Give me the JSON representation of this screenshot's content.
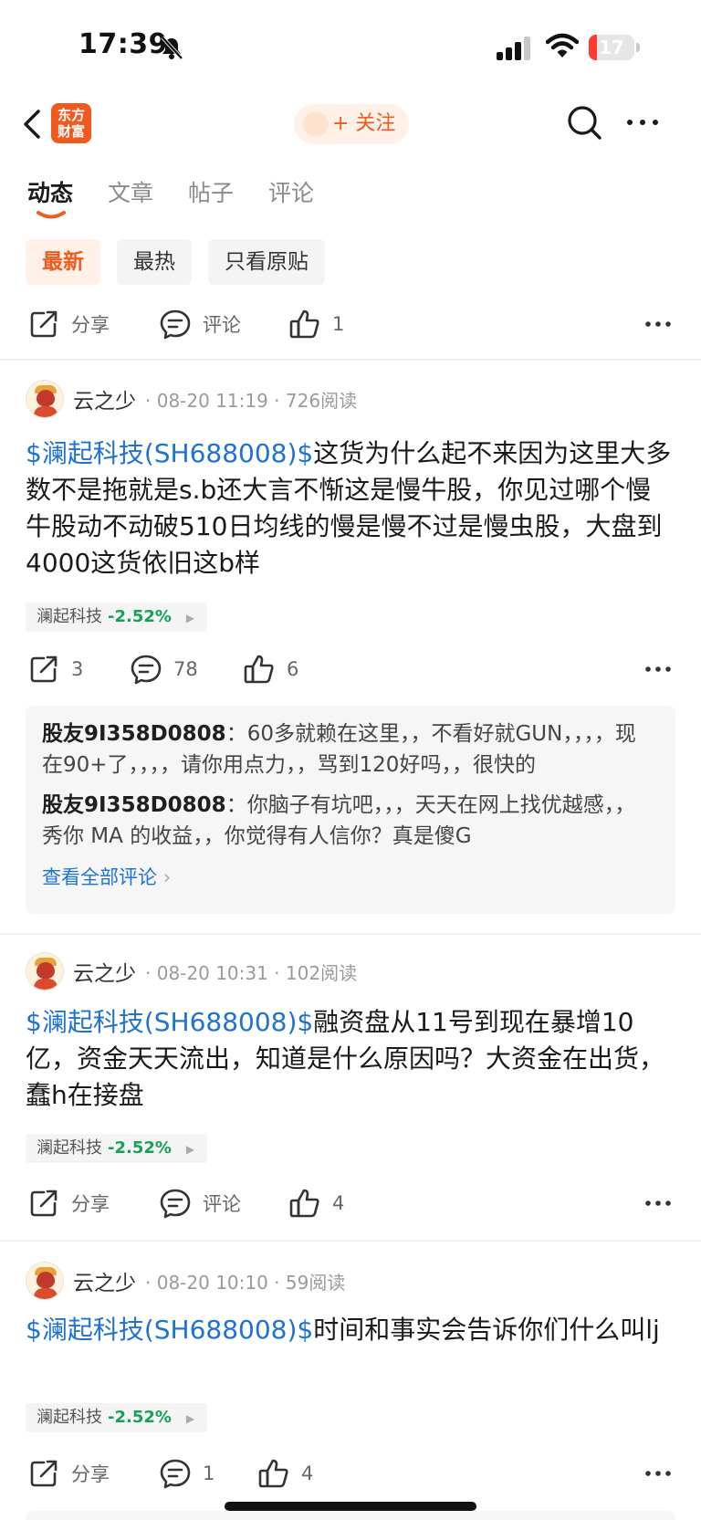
{
  "status_bar": {
    "time": "17:39",
    "battery": "17",
    "battery_level": 0.17
  },
  "nav": {
    "logo_text": "东方财富",
    "follow_label": "+ 关注"
  },
  "tabs": [
    {
      "label": "动态",
      "active": true
    },
    {
      "label": "文章",
      "active": false
    },
    {
      "label": "帖子",
      "active": false
    },
    {
      "label": "评论",
      "active": false
    }
  ],
  "filters": [
    {
      "label": "最新",
      "active": true
    },
    {
      "label": "最热",
      "active": false
    },
    {
      "label": "只看原贴",
      "active": false
    }
  ],
  "top_actions": {
    "share": "分享",
    "comment": "评论",
    "like": "1"
  },
  "posts": [
    {
      "username": "云之少",
      "date": "08-20 11:19",
      "reads": "726阅读",
      "stock_tag": "$澜起科技(SH688008)$",
      "text": "这货为什么起不来因为这里大多数不是拖就是s.b还大言不惭这是慢牛股，你见过哪个慢牛股动不动破510日均线的慢是慢不过是慢虫股，大盘到4000这货依旧这b样",
      "chip_name": "澜起科技",
      "chip_change": "-2.52%",
      "share": "3",
      "comment": "78",
      "like": "6",
      "comments": [
        {
          "user": "股友9I358D0808",
          "sep": "：",
          "text": "60多就赖在这里，，不看好就GUN，，，，现在90+了，，，，请你用点力，，骂到120好吗，，很快的"
        },
        {
          "user": "股友9I358D0808",
          "sep": "：",
          "text": "你脑子有坑吧，，，天天在网上找优越感，，秀你 MA 的收益，，你觉得有人信你？真是傻G"
        }
      ],
      "view_all": "查看全部评论"
    },
    {
      "username": "云之少",
      "date": "08-20 10:31",
      "reads": "102阅读",
      "stock_tag": "$澜起科技(SH688008)$",
      "text": "融资盘从11号到现在暴增10亿，资金天天流出，知道是什么原因吗？大资金在出货，蠢h在接盘",
      "chip_name": "澜起科技",
      "chip_change": "-2.52%",
      "share": "分享",
      "comment": "评论",
      "like": "4"
    },
    {
      "username": "云之少",
      "date": "08-20 10:10",
      "reads": "59阅读",
      "stock_tag": "$澜起科技(SH688008)$",
      "text": "时间和事实会告诉你们什么叫lj",
      "chip_name": "澜起科技",
      "chip_change": "-2.52%",
      "share": "分享",
      "comment": "1",
      "like": "4"
    }
  ]
}
